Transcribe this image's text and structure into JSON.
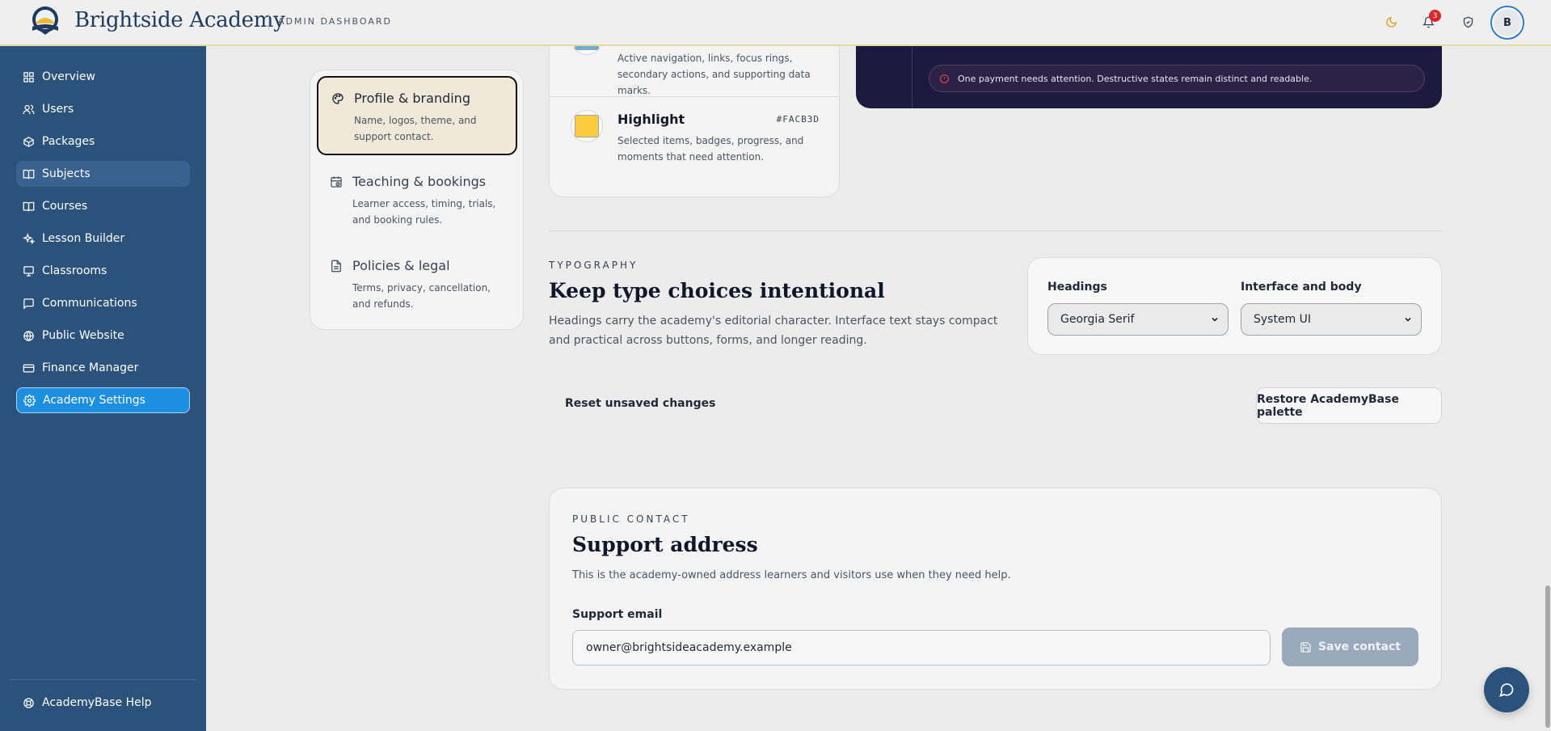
{
  "header": {
    "brand": "Brightside Academy",
    "subtitle": "ADMIN DASHBOARD",
    "notification_count": "3",
    "avatar_initial": "B"
  },
  "sidebar": {
    "items": [
      {
        "label": "Overview",
        "icon": "grid-icon"
      },
      {
        "label": "Users",
        "icon": "users-icon"
      },
      {
        "label": "Packages",
        "icon": "package-icon"
      },
      {
        "label": "Subjects",
        "icon": "book-open-icon"
      },
      {
        "label": "Courses",
        "icon": "book-icon"
      },
      {
        "label": "Lesson Builder",
        "icon": "sparkles-icon"
      },
      {
        "label": "Classrooms",
        "icon": "presentation-icon"
      },
      {
        "label": "Communications",
        "icon": "message-icon"
      },
      {
        "label": "Public Website",
        "icon": "globe-icon"
      },
      {
        "label": "Finance Manager",
        "icon": "credit-card-icon"
      },
      {
        "label": "Academy Settings",
        "icon": "gear-icon"
      }
    ],
    "active_index": 10,
    "hover_index": 3,
    "help_label": "AcademyBase Help"
  },
  "settings_nav": [
    {
      "title": "Profile & branding",
      "desc": "Name, logos, theme, and support contact."
    },
    {
      "title": "Teaching & bookings",
      "desc": "Learner access, timing, trials, and booking rules."
    },
    {
      "title": "Policies & legal",
      "desc": "Terms, privacy, cancellation, and refunds."
    }
  ],
  "colors": [
    {
      "name": "",
      "hex": "",
      "desc": "Active navigation, links, focus rings, secondary actions, and supporting data marks.",
      "swatch": "#6aaed6"
    },
    {
      "name": "Highlight",
      "hex": "#FACB3D",
      "desc": "Selected items, badges, progress, and moments that need attention.",
      "swatch": "#facb3d"
    }
  ],
  "preview": {
    "alert_text": "One payment needs attention. Destructive states remain distinct and readable."
  },
  "typography": {
    "eyebrow": "TYPOGRAPHY",
    "title": "Keep type choices intentional",
    "desc": "Headings carry the academy's editorial character. Interface text stays compact and practical across buttons, forms, and longer reading.",
    "headings_label": "Headings",
    "headings_value": "Georgia Serif",
    "body_label": "Interface and body",
    "body_value": "System UI"
  },
  "actions": {
    "reset": "Reset unsaved changes",
    "restore": "Restore AcademyBase palette"
  },
  "contact": {
    "eyebrow": "PUBLIC CONTACT",
    "title": "Support address",
    "desc": "This is the academy-owned address learners and visitors use when they need help.",
    "email_label": "Support email",
    "email_value": "owner@brightsideacademy.example",
    "save_label": "Save contact"
  }
}
